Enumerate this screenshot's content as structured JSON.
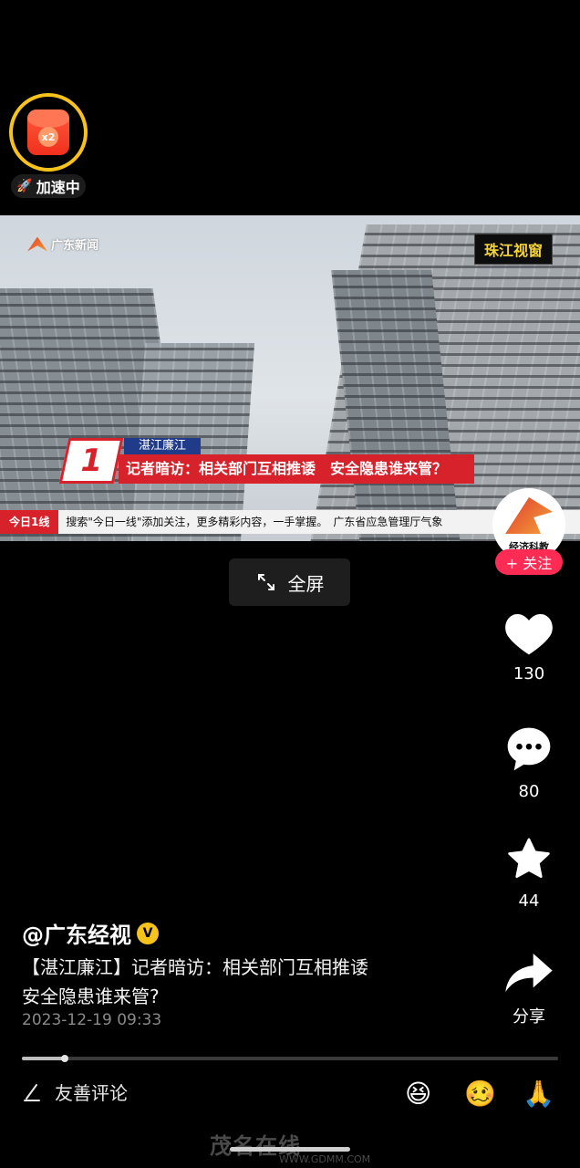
{
  "red_packet": {
    "multiplier": "x2",
    "status_label": "加速中"
  },
  "video": {
    "overlay": {
      "channel_logo": "广东新闻",
      "brand_tag": "珠江视窗",
      "news_number": "1",
      "location": "湛江廉江",
      "headline": "记者暗访：相关部门互相推诿　安全隐患谁来管？",
      "ticker_tag": "今日1线",
      "ticker_text": "搜索\"今日一线\"添加关注，更多精彩内容，一手掌握。　广东省应急管理厅气象"
    }
  },
  "fullscreen_label": "全屏",
  "side_rail": {
    "avatar_text": "经济科教",
    "follow_label": "+ 关注",
    "likes": "130",
    "comments": "80",
    "favorites": "44",
    "share_label": "分享"
  },
  "post": {
    "author": "@广东经视",
    "verified_badge": "V",
    "description_line1": "【湛江廉江】记者暗访：相关部门互相推诿",
    "description_line2": "安全隐患谁来管?",
    "timestamp": "2023-12-19 09:33",
    "progress": 0.08
  },
  "comment_input": {
    "placeholder": "友善评论"
  },
  "emojis": [
    "😆",
    "🥴",
    "🙏"
  ],
  "watermark": {
    "main": "茂名在线",
    "sub": "WWW.GDMM.COM"
  },
  "colors": {
    "accent": "#fe2c55",
    "gold": "#f6c21b",
    "news_red": "#d8222b"
  }
}
